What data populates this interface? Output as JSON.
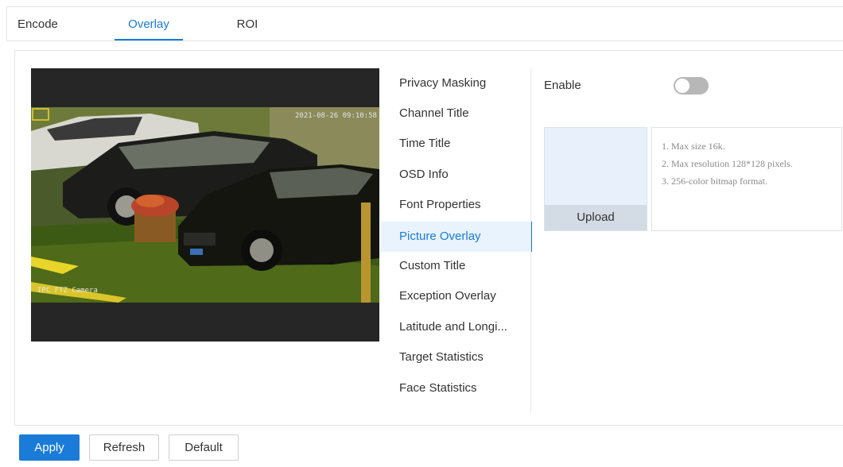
{
  "tabs": [
    {
      "label": "Encode"
    },
    {
      "label": "Overlay"
    },
    {
      "label": "ROI"
    }
  ],
  "active_tab": "Overlay",
  "video": {
    "timestamp_text": "2021-08-26 09:10:58",
    "channel_text": "IPC FTZ Camera"
  },
  "menu": {
    "items": [
      {
        "label": "Privacy Masking"
      },
      {
        "label": "Channel Title"
      },
      {
        "label": "Time Title"
      },
      {
        "label": "OSD Info"
      },
      {
        "label": "Font Properties"
      },
      {
        "label": "Picture Overlay"
      },
      {
        "label": "Custom Title"
      },
      {
        "label": "Exception Overlay"
      },
      {
        "label": "Latitude and Longi..."
      },
      {
        "label": "Target Statistics"
      },
      {
        "label": "Face Statistics"
      }
    ],
    "active": "Picture Overlay"
  },
  "settings": {
    "enable_label": "Enable",
    "enable_on": false,
    "upload_label": "Upload",
    "hints": [
      "1. Max size 16k.",
      "2. Max resolution 128*128 pixels.",
      "3. 256-color bitmap format."
    ]
  },
  "buttons": {
    "apply": "Apply",
    "refresh": "Refresh",
    "default": "Default"
  },
  "colors": {
    "accent": "#1a7bd8",
    "toggle_off": "#b7b7b7",
    "upload_bg": "#e8f1fb"
  }
}
